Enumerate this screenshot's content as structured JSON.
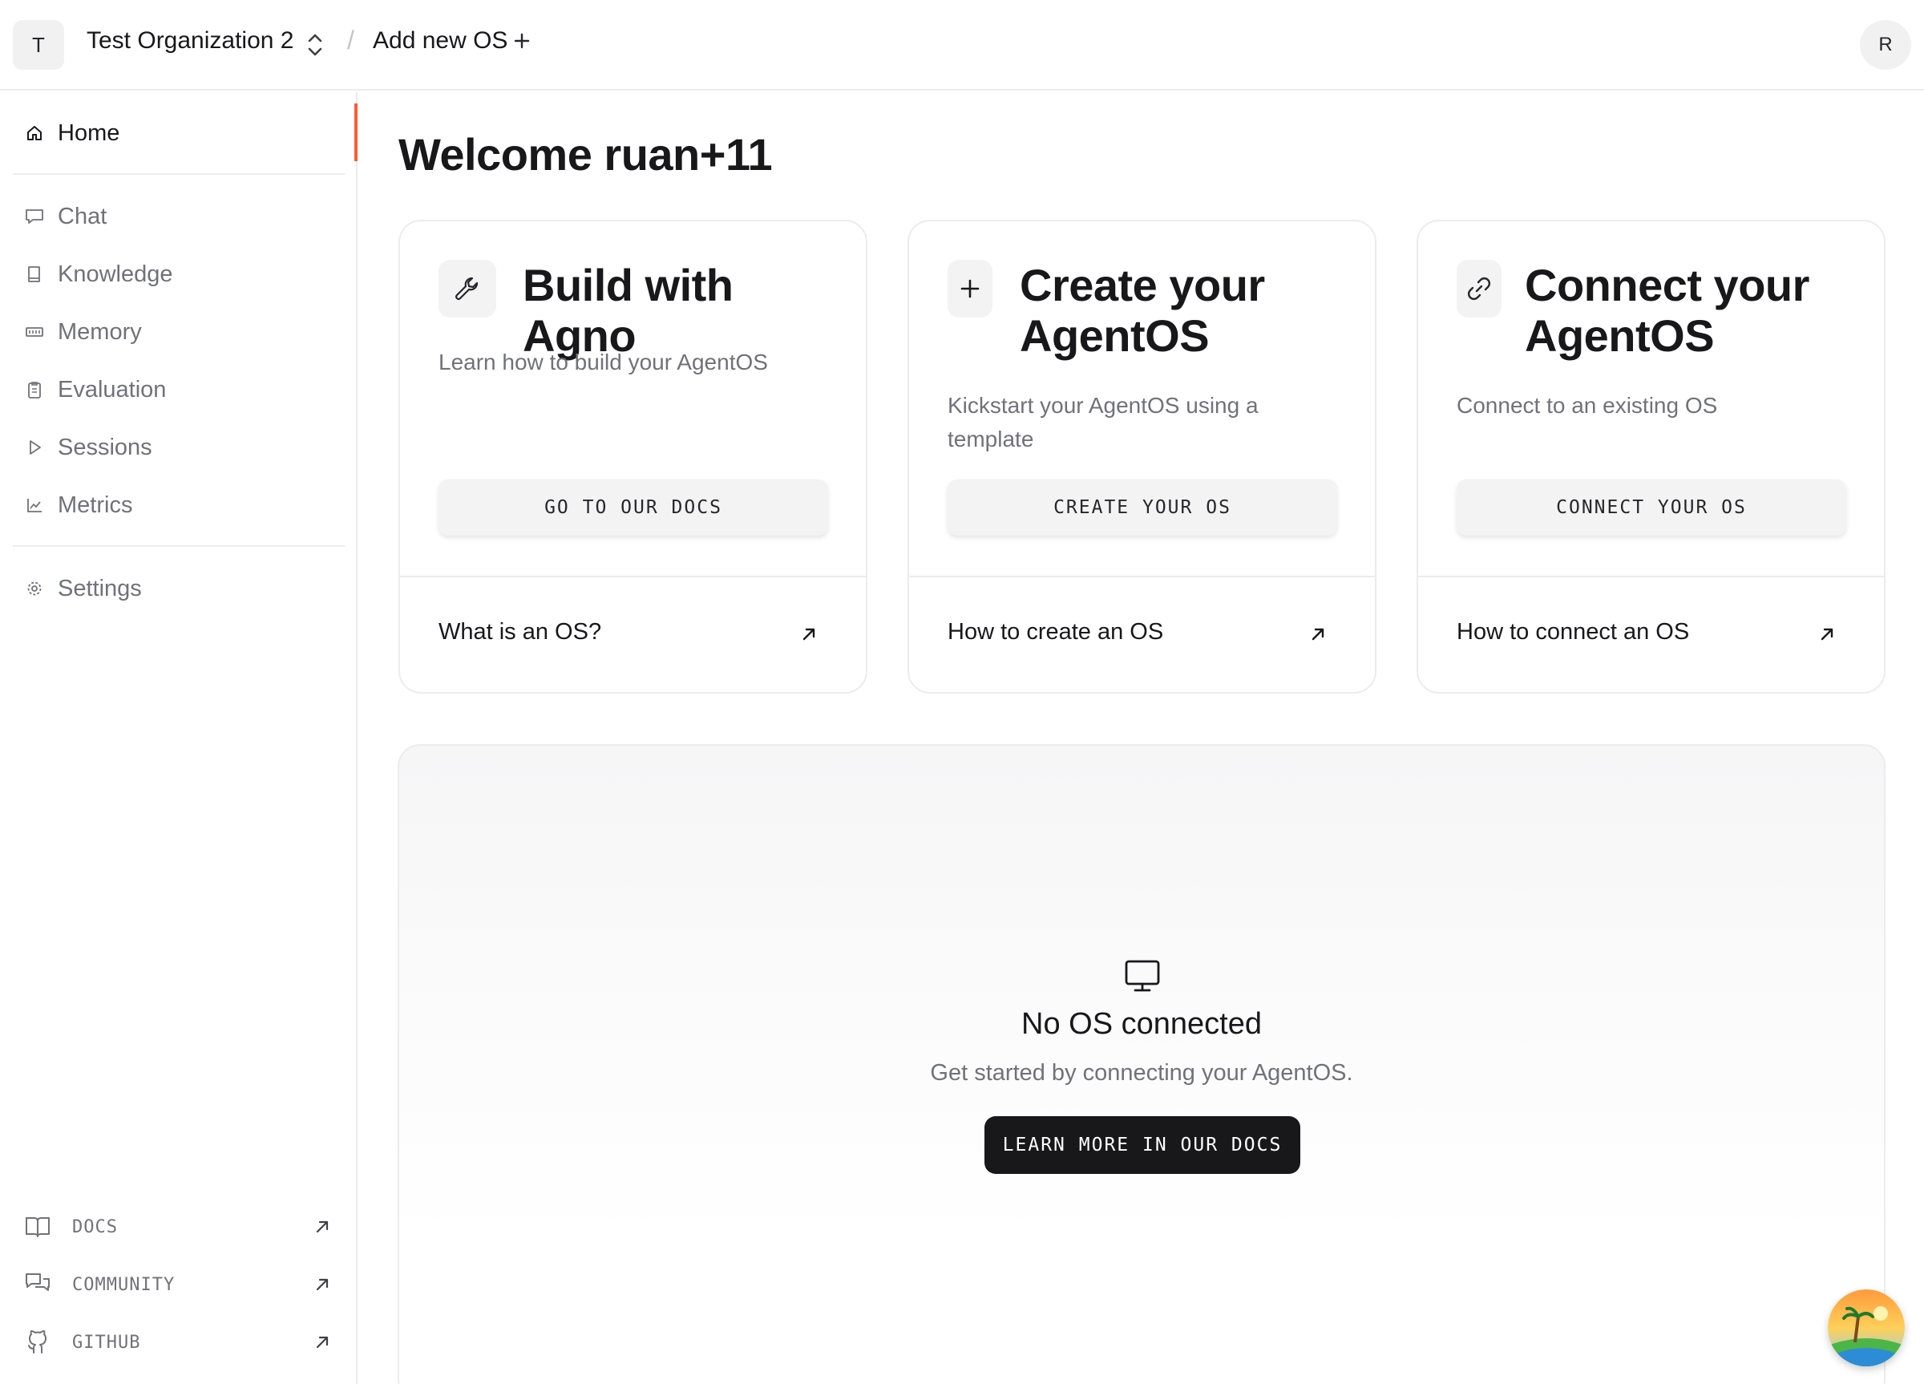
{
  "topbar": {
    "org_initial": "T",
    "org_name": "Test Organization 2",
    "separator": "/",
    "add_os_label": "Add new OS",
    "user_initial": "R"
  },
  "sidebar": {
    "home": "Home",
    "items": [
      {
        "label": "Chat",
        "icon": "chat-icon"
      },
      {
        "label": "Knowledge",
        "icon": "book-icon"
      },
      {
        "label": "Memory",
        "icon": "memory-icon"
      },
      {
        "label": "Evaluation",
        "icon": "clipboard-icon"
      },
      {
        "label": "Sessions",
        "icon": "play-icon"
      },
      {
        "label": "Metrics",
        "icon": "chart-icon"
      }
    ],
    "settings": "Settings",
    "external": [
      {
        "label": "DOCS",
        "icon": "book-open-icon"
      },
      {
        "label": "COMMUNITY",
        "icon": "chat-bubbles-icon"
      },
      {
        "label": "GITHUB",
        "icon": "github-icon"
      }
    ]
  },
  "main": {
    "welcome": "Welcome ruan+11",
    "cards": [
      {
        "icon": "wrench-icon",
        "title": "Build with Agno",
        "description": "Learn how to build your AgentOS",
        "button": "GO TO OUR DOCS",
        "link": "What is an OS?"
      },
      {
        "icon": "plus-icon",
        "title": "Create your AgentOS",
        "description": "Kickstart your AgentOS using a template",
        "button": "CREATE YOUR OS",
        "link": "How to create an OS"
      },
      {
        "icon": "link-icon",
        "title": "Connect your AgentOS",
        "description": "Connect to an existing OS",
        "button": "CONNECT YOUR OS",
        "link": "How to connect an OS"
      }
    ],
    "empty_state": {
      "icon": "monitor-icon",
      "title": "No OS connected",
      "description": "Get started by connecting your AgentOS.",
      "button": "LEARN MORE IN OUR DOCS"
    }
  },
  "colors": {
    "accent": "#ff5a36",
    "text": "#18181b",
    "muted": "#71717a",
    "border": "#ececee",
    "dark_button": "#18181b"
  }
}
